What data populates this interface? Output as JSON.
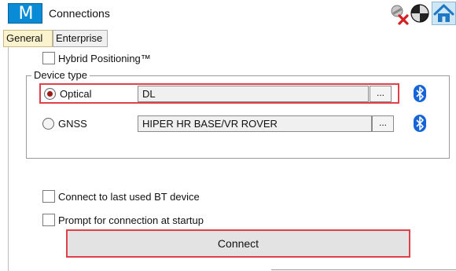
{
  "window": {
    "logo_letter": "M",
    "title": "Connections"
  },
  "tabs": [
    {
      "label": "General",
      "active": true
    },
    {
      "label": "Enterprise",
      "active": false
    }
  ],
  "general": {
    "hybrid_positioning": {
      "label": "Hybrid Positioning™",
      "checked": false
    },
    "device_type": {
      "legend": "Device type",
      "options": [
        {
          "label": "Optical",
          "selected": true,
          "device": "DL",
          "browse_label": "..."
        },
        {
          "label": "GNSS",
          "selected": false,
          "device": "HIPER HR BASE/VR ROVER",
          "browse_label": "..."
        }
      ]
    },
    "connect_last_bt": {
      "label": "Connect to last used BT device",
      "checked": false
    },
    "prompt_startup": {
      "label": "Prompt for connection at startup",
      "checked": false
    },
    "connect_button": "Connect"
  },
  "icons": {
    "satellite": "satellite-disconnected-icon",
    "globe": "globe-icon",
    "home": "home-icon",
    "bluetooth": "bluetooth-icon"
  },
  "colors": {
    "brand": "#0a8bd6",
    "highlight": "#e0404a",
    "active_tab": "#fbf3cd",
    "bluetooth": "#1565d8"
  }
}
